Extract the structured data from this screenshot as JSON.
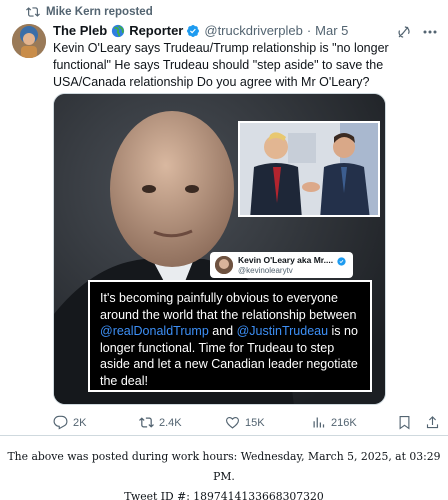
{
  "repost": {
    "label": "Mike Kern reposted"
  },
  "author": {
    "name": "The Pleb",
    "name2": "Reporter",
    "handle": "@truckdriverpleb",
    "date": "Mar 5"
  },
  "post": {
    "text": "Kevin O'Leary says Trudeau/Trump relationship is \"no longer functional\" He says Trudeau should \"step aside\" to save the USA/Canada relationship Do you agree with Mr O'Leary?"
  },
  "image": {
    "quote_name": "Kevin O'Leary aka Mr....",
    "quote_handle": "@kevinolearytv",
    "quote_part1": "It's becoming painfully obvious to everyone around the world that the relationship between ",
    "mention1": "@realDonaldTrump",
    "quote_part2": " and ",
    "mention2": "@JustinTrudeau",
    "quote_part3": " is no longer functional. Time for Trudeau to step aside and let a new Canadian leader negotiate the deal!"
  },
  "actions": {
    "replies": "2K",
    "reposts": "2.4K",
    "likes": "15K",
    "views": "216K"
  },
  "footer": {
    "line1": "The above was posted during work hours: Wednesday, March 5, 2025, at 03:29 PM.",
    "line2": "Tweet ID #: 1897414133668307320"
  },
  "colors": {
    "verified": "#1d9bf0",
    "mention": "#3d8ff5",
    "muted": "#536471"
  }
}
